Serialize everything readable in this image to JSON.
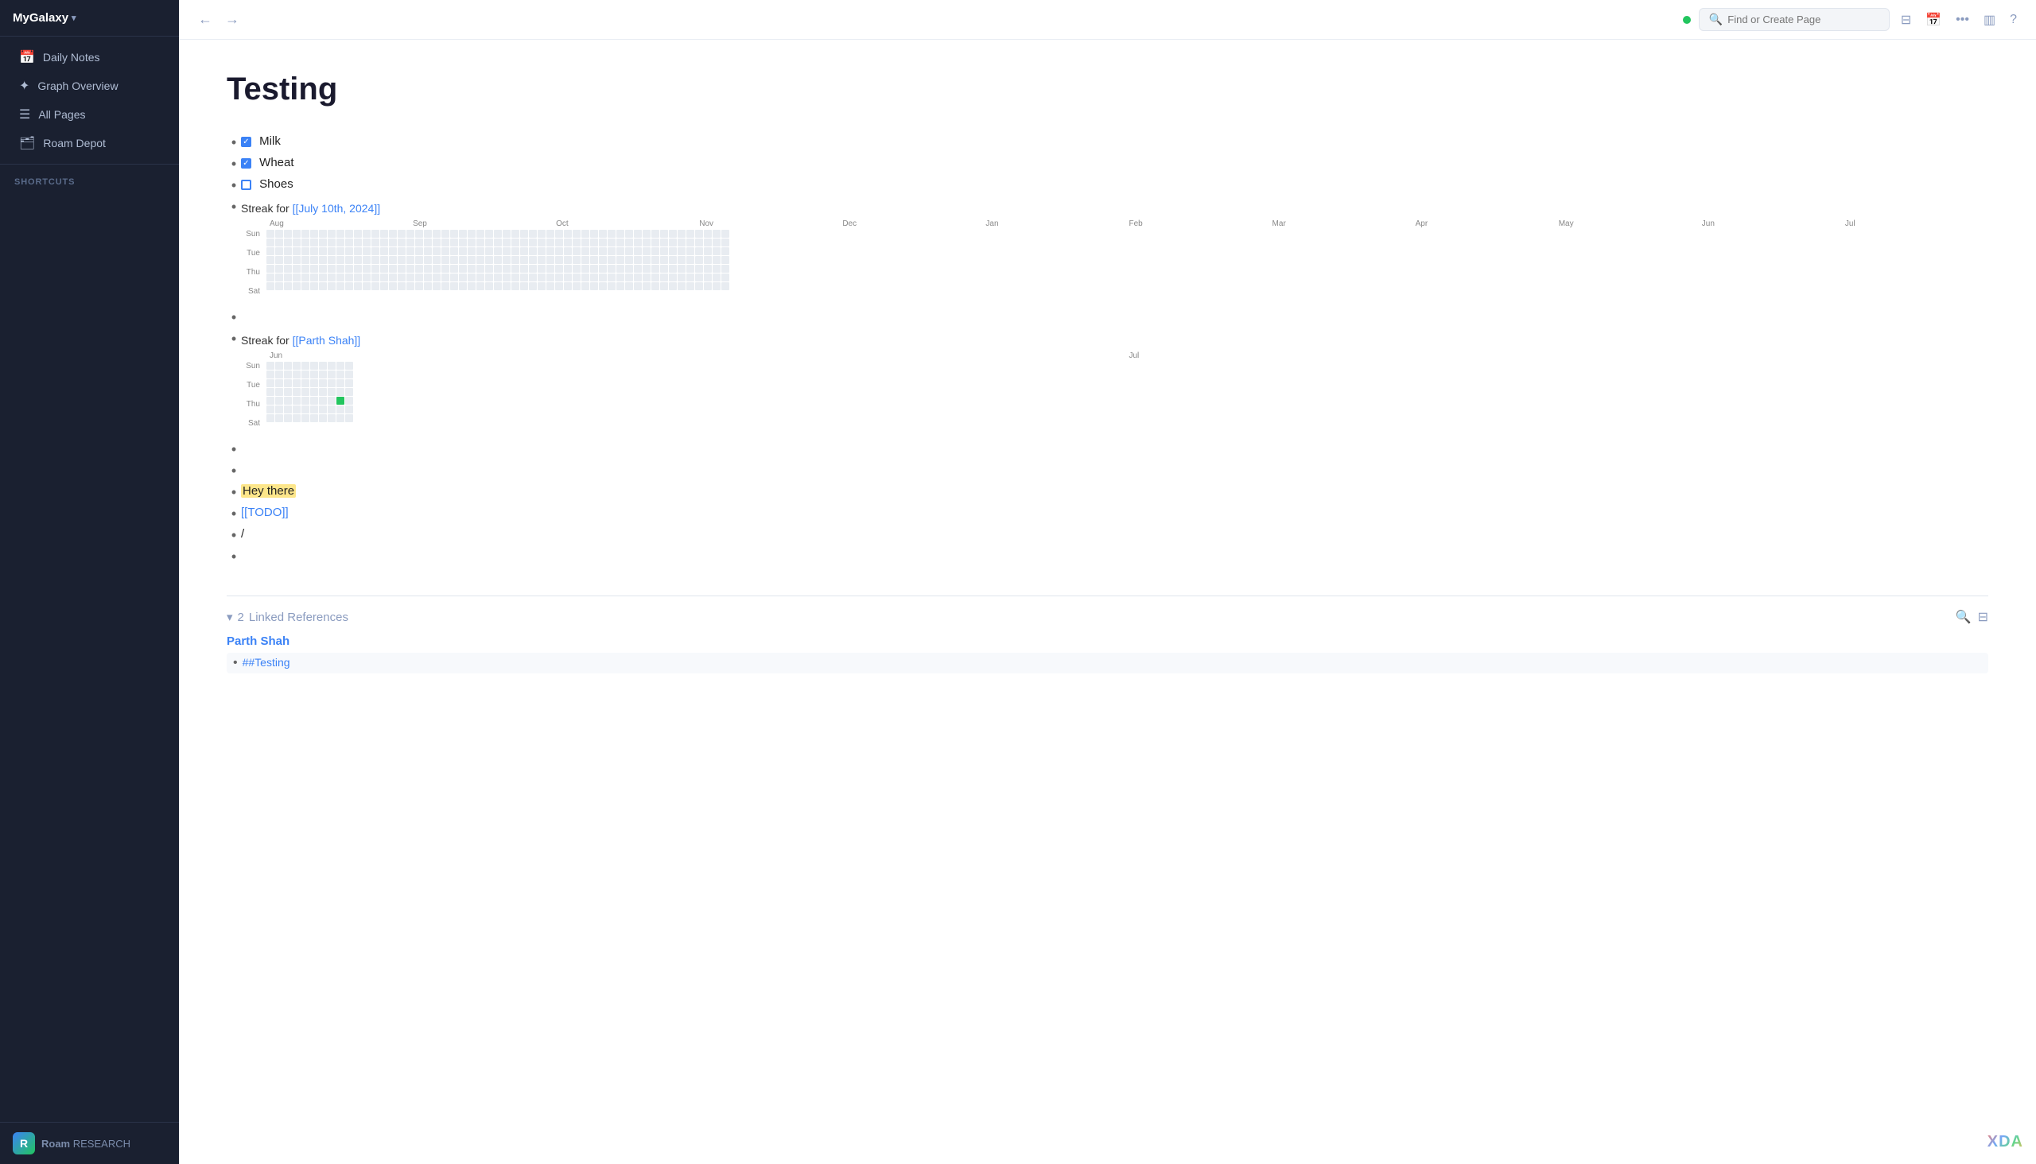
{
  "sidebar": {
    "workspace_name": "MyGalaxy",
    "chevron": "▾",
    "nav_items": [
      {
        "id": "daily-notes",
        "icon": "📅",
        "label": "Daily Notes"
      },
      {
        "id": "graph-overview",
        "icon": "🌐",
        "label": "Graph Overview"
      },
      {
        "id": "all-pages",
        "icon": "☰",
        "label": "All Pages"
      },
      {
        "id": "roam-depot",
        "icon": "🗂",
        "label": "Roam Depot"
      }
    ],
    "shortcuts_label": "SHORTCUTS",
    "bottom": {
      "logo_text": "R",
      "brand": "Roam",
      "brand_sub": "RESEARCH"
    }
  },
  "topbar": {
    "back_icon": "←",
    "forward_icon": "→",
    "search_placeholder": "Find or Create Page",
    "filter_icon": "⊟",
    "calendar_icon": "📅",
    "more_icon": "•••",
    "columns_icon": "▥",
    "help_icon": "?",
    "settings_icon": "⚙"
  },
  "page": {
    "title": "Testing",
    "items": [
      {
        "type": "checkbox",
        "checked": true,
        "text": "Milk"
      },
      {
        "type": "checkbox",
        "checked": true,
        "text": "Wheat"
      },
      {
        "type": "checkbox",
        "checked": false,
        "text": "Shoes"
      },
      {
        "type": "streak",
        "title": "Streak for [[July 10th, 2024]]",
        "months": [
          "Aug",
          "Sep",
          "Oct",
          "Nov",
          "Dec",
          "Jan",
          "Feb",
          "Mar",
          "Apr",
          "May",
          "Jun",
          "Jul"
        ],
        "days": [
          "Sun",
          "Tue",
          "Thu",
          "Sat"
        ],
        "active_cells": []
      },
      {
        "type": "bullet",
        "text": ""
      },
      {
        "type": "streak",
        "title": "Streak for [[Parth Shah]]",
        "months": [
          "Jun",
          "Jul"
        ],
        "days": [
          "Sun",
          "Tue",
          "Thu",
          "Sat"
        ],
        "active_cells": [
          [
            4,
            2
          ]
        ]
      },
      {
        "type": "bullet",
        "text": ""
      },
      {
        "type": "bullet",
        "text": ""
      },
      {
        "type": "highlight",
        "text": "Hey there",
        "color": "yellow"
      },
      {
        "type": "link",
        "text": "[[TODO]]"
      },
      {
        "type": "bullet",
        "text": "/"
      },
      {
        "type": "bullet",
        "text": ""
      }
    ],
    "linked_refs": {
      "count": 2,
      "label": "Linked References",
      "groups": [
        {
          "name": "Parth Shah",
          "items": [
            {
              "text": "##Testing"
            }
          ]
        }
      ]
    }
  },
  "xda": "XDA"
}
